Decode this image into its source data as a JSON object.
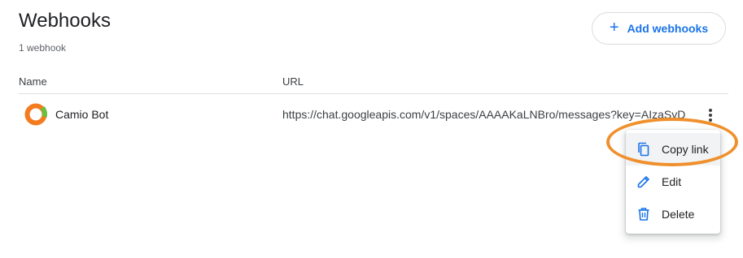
{
  "header": {
    "title": "Webhooks",
    "count": "1 webhook",
    "add_button": {
      "label": "Add webhooks",
      "icon": "plus-icon"
    }
  },
  "table": {
    "columns": [
      "Name",
      "URL"
    ],
    "rows": [
      {
        "name": "Camio Bot",
        "avatar_icon": "camio-logo-icon",
        "url": "https://chat.googleapis.com/v1/spaces/AAAAKaLNBro/messages?key=AIzaSyD"
      }
    ]
  },
  "context_menu": {
    "items": [
      {
        "label": "Copy link",
        "icon": "copy-icon"
      },
      {
        "label": "Edit",
        "icon": "pencil-icon"
      },
      {
        "label": "Delete",
        "icon": "trash-icon"
      }
    ]
  },
  "colors": {
    "accent": "#1a73e8",
    "highlight": "#f0902c",
    "logo_orange": "#f47c20",
    "logo_green": "#6bbf3c"
  }
}
